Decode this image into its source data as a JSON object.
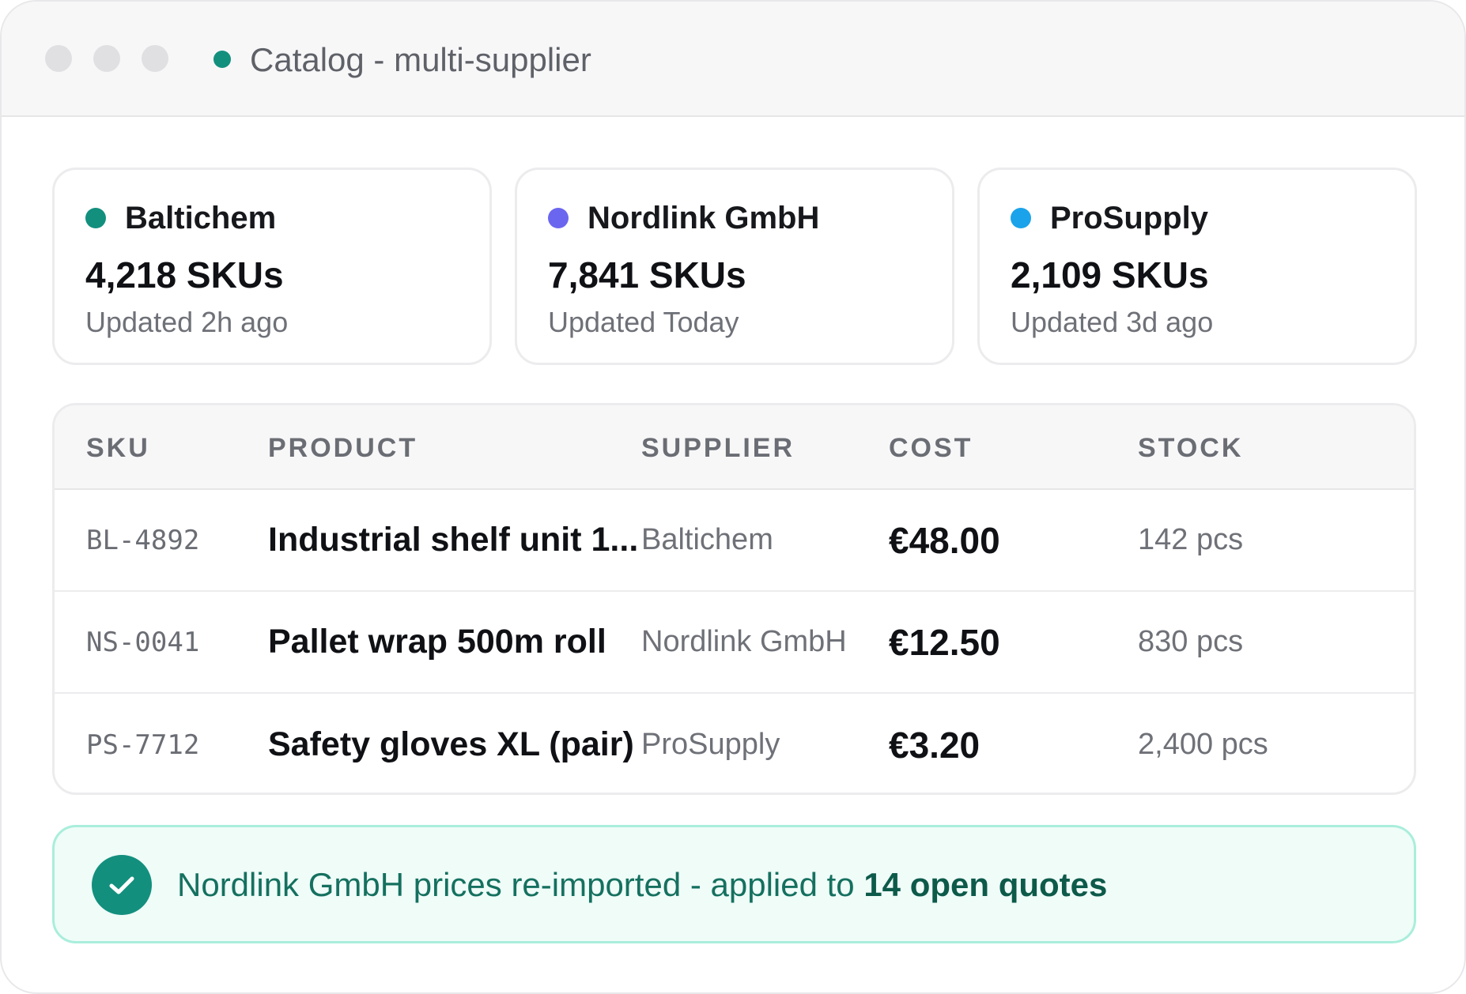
{
  "window": {
    "title": "Catalog - multi-supplier",
    "status_color": "#138f7e"
  },
  "suppliers": [
    {
      "name": "Baltichem",
      "skus": "4,218 SKUs",
      "updated": "Updated 2h ago",
      "color": "#138f7e"
    },
    {
      "name": "Nordlink GmbH",
      "skus": "7,841 SKUs",
      "updated": "Updated Today",
      "color": "#6b66ef"
    },
    {
      "name": "ProSupply",
      "skus": "2,109 SKUs",
      "updated": "Updated 3d ago",
      "color": "#1aa3ea"
    }
  ],
  "table": {
    "columns": [
      "SKU",
      "PRODUCT",
      "SUPPLIER",
      "COST",
      "STOCK"
    ],
    "rows": [
      {
        "sku": "BL-4892",
        "product": "Industrial shelf unit 1...",
        "supplier": "Baltichem",
        "cost": "€48.00",
        "stock": "142 pcs"
      },
      {
        "sku": "NS-0041",
        "product": "Pallet wrap 500m roll",
        "supplier": "Nordlink GmbH",
        "cost": "€12.50",
        "stock": "830 pcs"
      },
      {
        "sku": "PS-7712",
        "product": "Safety gloves XL (pair)",
        "supplier": "ProSupply",
        "cost": "€3.20",
        "stock": "2,400 pcs"
      }
    ]
  },
  "banner": {
    "icon": "check-icon",
    "text": "Nordlink GmbH prices re-imported - applied to ",
    "highlight": "14 open quotes"
  }
}
